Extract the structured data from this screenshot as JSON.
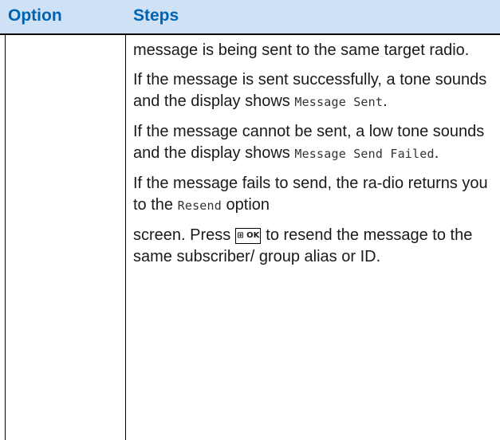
{
  "table": {
    "header": {
      "option": "Option",
      "steps": "Steps"
    },
    "paragraphs": {
      "p1": "message is being sent to the same target radio.",
      "p2_pre": "If the message is sent successfully, a tone sounds and the display shows ",
      "p2_mono": "Message Sent",
      "p2_post": ".",
      "p3_pre": "If the message cannot be sent, a low tone sounds and the display shows ",
      "p3_mono": "Message Send Failed",
      "p3_post": ".",
      "p4_pre": "If the message fails to send, the ra-dio returns you to the ",
      "p4_mono": "Resend",
      "p4_post": " option",
      "p5_pre": "screen. Press",
      "p5_key": "⊞ OK",
      "p5_post": "to resend the message to the same subscriber/ group alias or ID."
    }
  }
}
